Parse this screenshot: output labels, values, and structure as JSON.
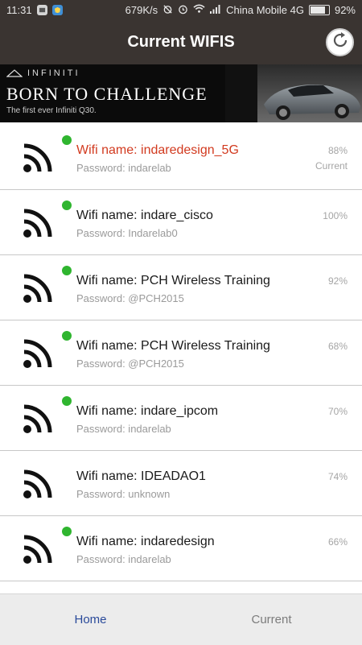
{
  "status_bar": {
    "time": "11:31",
    "speed": "679K/s",
    "carrier": "China Mobile 4G",
    "battery": "92%",
    "battery_level": 0.92
  },
  "header": {
    "title": "Current WIFIS",
    "refresh_icon": "refresh-icon"
  },
  "ad": {
    "brand": "INFINITI",
    "headline": "BORN TO CHALLENGE",
    "subtext": "The first ever Infiniti Q30."
  },
  "wifi_list": [
    {
      "name": "Wifi name: indaredesign_5G",
      "password": "Password: indarelab",
      "signal": "88%",
      "status": "Current",
      "is_current": true,
      "online": true
    },
    {
      "name": "Wifi name: indare_cisco",
      "password": "Password: Indarelab0",
      "signal": "100%",
      "status": "",
      "is_current": false,
      "online": true
    },
    {
      "name": "Wifi name: PCH Wireless Training",
      "password": "Password: @PCH2015",
      "signal": "92%",
      "status": "",
      "is_current": false,
      "online": true
    },
    {
      "name": "Wifi name: PCH Wireless Training",
      "password": "Password: @PCH2015",
      "signal": "68%",
      "status": "",
      "is_current": false,
      "online": true
    },
    {
      "name": "Wifi name: indare_ipcom",
      "password": "Password: indarelab",
      "signal": "70%",
      "status": "",
      "is_current": false,
      "online": true
    },
    {
      "name": "Wifi name: IDEADAO1",
      "password": "Password: unknown",
      "signal": "74%",
      "status": "",
      "is_current": false,
      "online": false
    },
    {
      "name": "Wifi name: indaredesign",
      "password": "Password: indarelab",
      "signal": "66%",
      "status": "",
      "is_current": false,
      "online": true
    }
  ],
  "tabs": {
    "home": "Home",
    "current": "Current"
  },
  "colors": {
    "header_bg": "#3a3431",
    "current_name": "#d23a1f",
    "online_dot": "#2fb52f",
    "active_tab": "#2a4a9a"
  }
}
